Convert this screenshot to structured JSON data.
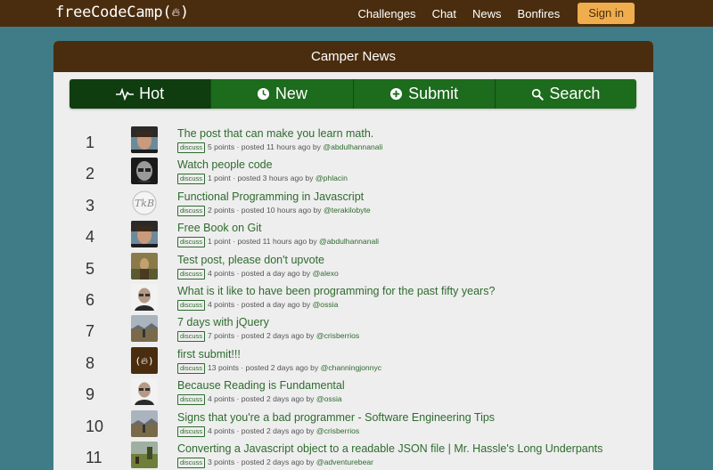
{
  "nav": {
    "brand_text": "freeCodeCamp(",
    "brand_close": ")",
    "links": [
      "Challenges",
      "Chat",
      "News",
      "Bonfires"
    ],
    "signin_label": "Sign in"
  },
  "panel": {
    "heading": "Camper News"
  },
  "tabs": [
    {
      "label": "Hot",
      "icon": "pulse-icon"
    },
    {
      "label": "New",
      "icon": "clock-icon"
    },
    {
      "label": "Submit",
      "icon": "plus-circle-icon"
    },
    {
      "label": "Search",
      "icon": "search-icon"
    }
  ],
  "discuss_label": "discuss",
  "stories": [
    {
      "rank": "1",
      "title": "The post that can make you learn math.",
      "points": "5 points",
      "posted": "posted 11 hours ago by",
      "user": "@abdulhannanali",
      "avatar": "boy"
    },
    {
      "rank": "2",
      "title": "Watch people code",
      "points": "1 point",
      "posted": "posted 3 hours ago by",
      "user": "@phlacin",
      "avatar": "glasses"
    },
    {
      "rank": "3",
      "title": "Functional Programming in Javascript",
      "points": "2 points",
      "posted": "posted 10 hours ago by",
      "user": "@terakilobyte",
      "avatar": "logo"
    },
    {
      "rank": "4",
      "title": "Free Book on Git",
      "points": "1 point",
      "posted": "posted 11 hours ago by",
      "user": "@abdulhannanali",
      "avatar": "boy"
    },
    {
      "rank": "5",
      "title": "Test post, please don't upvote",
      "points": "4 points",
      "posted": "posted a day ago by",
      "user": "@alexo",
      "avatar": "outdoor"
    },
    {
      "rank": "6",
      "title": "What is it like to have been programming for the past fifty years?",
      "points": "4 points",
      "posted": "posted a day ago by",
      "user": "@ossia",
      "avatar": "bald"
    },
    {
      "rank": "7",
      "title": "7 days with jQuery",
      "points": "7 points",
      "posted": "posted 2 days ago by",
      "user": "@crisberrios",
      "avatar": "landscape"
    },
    {
      "rank": "8",
      "title": "first submit!!!",
      "points": "13 points",
      "posted": "posted 2 days ago by",
      "user": "@channingjonnyc",
      "avatar": "fcc"
    },
    {
      "rank": "9",
      "title": "Because Reading is Fundamental",
      "points": "4 points",
      "posted": "posted 2 days ago by",
      "user": "@ossia",
      "avatar": "bald"
    },
    {
      "rank": "10",
      "title": "Signs that you're a bad programmer - Software Engineering Tips",
      "points": "4 points",
      "posted": "posted 2 days ago by",
      "user": "@crisberrios",
      "avatar": "landscape"
    },
    {
      "rank": "11",
      "title": "Converting a Javascript object to a readable JSON file | Mr. Hassle's Long Underpants",
      "points": "3 points",
      "posted": "posted 2 days ago by",
      "user": "@adventurebear",
      "avatar": "field"
    }
  ],
  "colors": {
    "navbar": "#4a2d0e",
    "background": "#3f7c87",
    "tab": "#1d6b1d",
    "tab_active": "#0f3d0f",
    "link": "#2e6b2e",
    "signin": "#f0ad4e"
  }
}
